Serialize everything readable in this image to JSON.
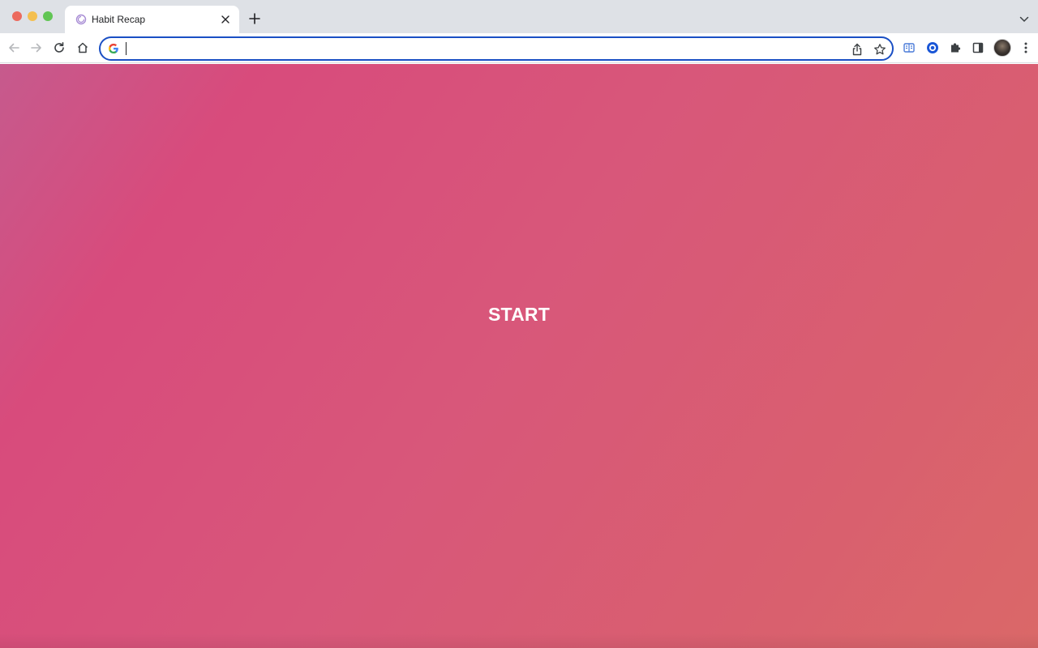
{
  "browser": {
    "tab": {
      "title": "Habit Recap"
    },
    "omnibox": {
      "value": "",
      "placeholder": ""
    }
  },
  "page": {
    "start_label": "START"
  },
  "icons": {
    "back": "arrow-left-icon",
    "forward": "arrow-right-icon",
    "reload": "reload-icon",
    "home": "home-icon",
    "google": "google-icon",
    "share": "share-icon",
    "bookmark": "star-icon",
    "extension_1": "reader-icon",
    "extension_2": "circle-o-icon",
    "extensions": "puzzle-icon",
    "side_panel": "side-panel-icon",
    "menu": "kebab-menu-icon"
  },
  "colors": {
    "accent": "#1a4fc4",
    "page_gradient_start": "#c65a8d",
    "page_gradient_end": "#da6868"
  }
}
